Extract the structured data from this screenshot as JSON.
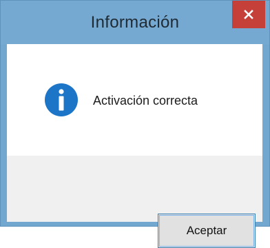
{
  "window": {
    "title": "Información",
    "close_icon": "close-icon"
  },
  "dialog": {
    "icon": "info-icon",
    "icon_color": "#1c75c6",
    "message": "Activación correcta",
    "ok_label": "Aceptar"
  }
}
